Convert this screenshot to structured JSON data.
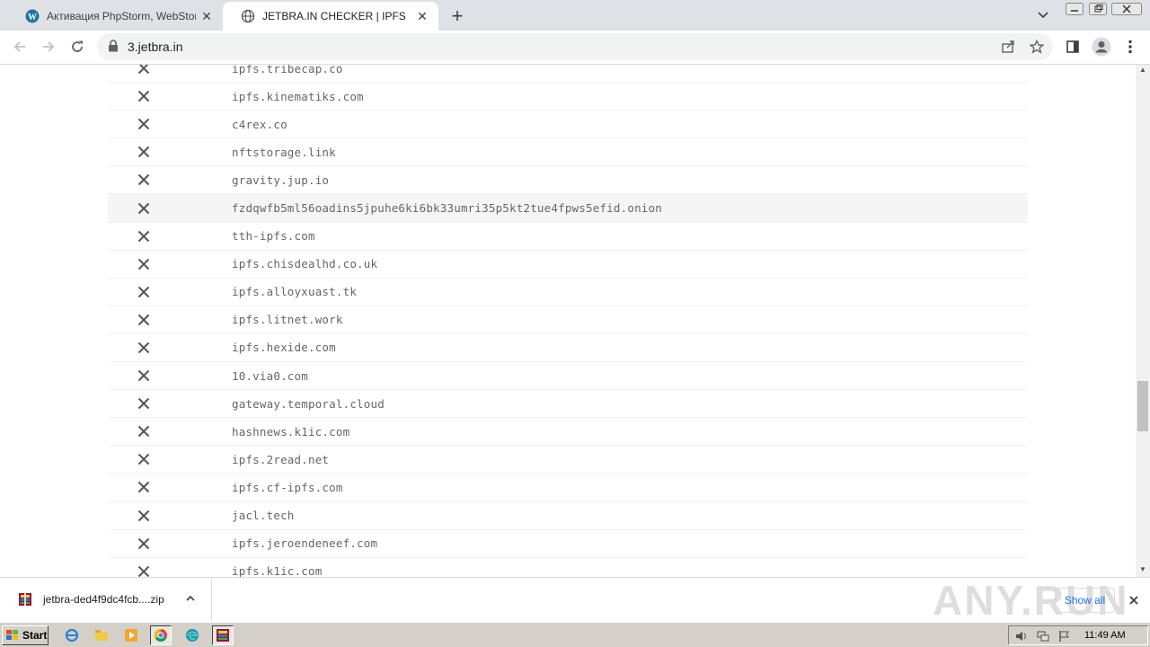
{
  "tabs": [
    {
      "title": "Активация PhpStorm, WebStorm, IntelliJ",
      "active": false
    },
    {
      "title": "JETBRA.IN CHECKER | IPFS",
      "active": true
    }
  ],
  "address_bar": {
    "url": "3.jetbra.in"
  },
  "hosts": [
    {
      "host": "ipfs.tribecap.co",
      "status": "failed"
    },
    {
      "host": "ipfs.kinematiks.com",
      "status": "failed"
    },
    {
      "host": "c4rex.co",
      "status": "failed"
    },
    {
      "host": "nftstorage.link",
      "status": "failed"
    },
    {
      "host": "gravity.jup.io",
      "status": "failed"
    },
    {
      "host": "fzdqwfb5ml56oadins5jpuhe6ki6bk33umri35p5kt2tue4fpws5efid.onion",
      "status": "failed",
      "highlighted": true
    },
    {
      "host": "tth-ipfs.com",
      "status": "failed"
    },
    {
      "host": "ipfs.chisdealhd.co.uk",
      "status": "failed"
    },
    {
      "host": "ipfs.alloyxuast.tk",
      "status": "failed"
    },
    {
      "host": "ipfs.litnet.work",
      "status": "failed"
    },
    {
      "host": "ipfs.hexide.com",
      "status": "failed"
    },
    {
      "host": "10.via0.com",
      "status": "failed"
    },
    {
      "host": "gateway.temporal.cloud",
      "status": "failed"
    },
    {
      "host": "hashnews.k1ic.com",
      "status": "failed"
    },
    {
      "host": "ipfs.2read.net",
      "status": "failed"
    },
    {
      "host": "ipfs.cf-ipfs.com",
      "status": "failed"
    },
    {
      "host": "jacl.tech",
      "status": "failed"
    },
    {
      "host": "ipfs.jeroendeneef.com",
      "status": "failed"
    },
    {
      "host": "ipfs.k1ic.com",
      "status": "failed"
    }
  ],
  "download_bar": {
    "file_name": "jetbra-ded4f9dc4fcb....zip",
    "show_all_label": "Show all"
  },
  "watermark": "ANY.RUN",
  "taskbar": {
    "start_label": "Start",
    "clock": "11:49 AM"
  }
}
